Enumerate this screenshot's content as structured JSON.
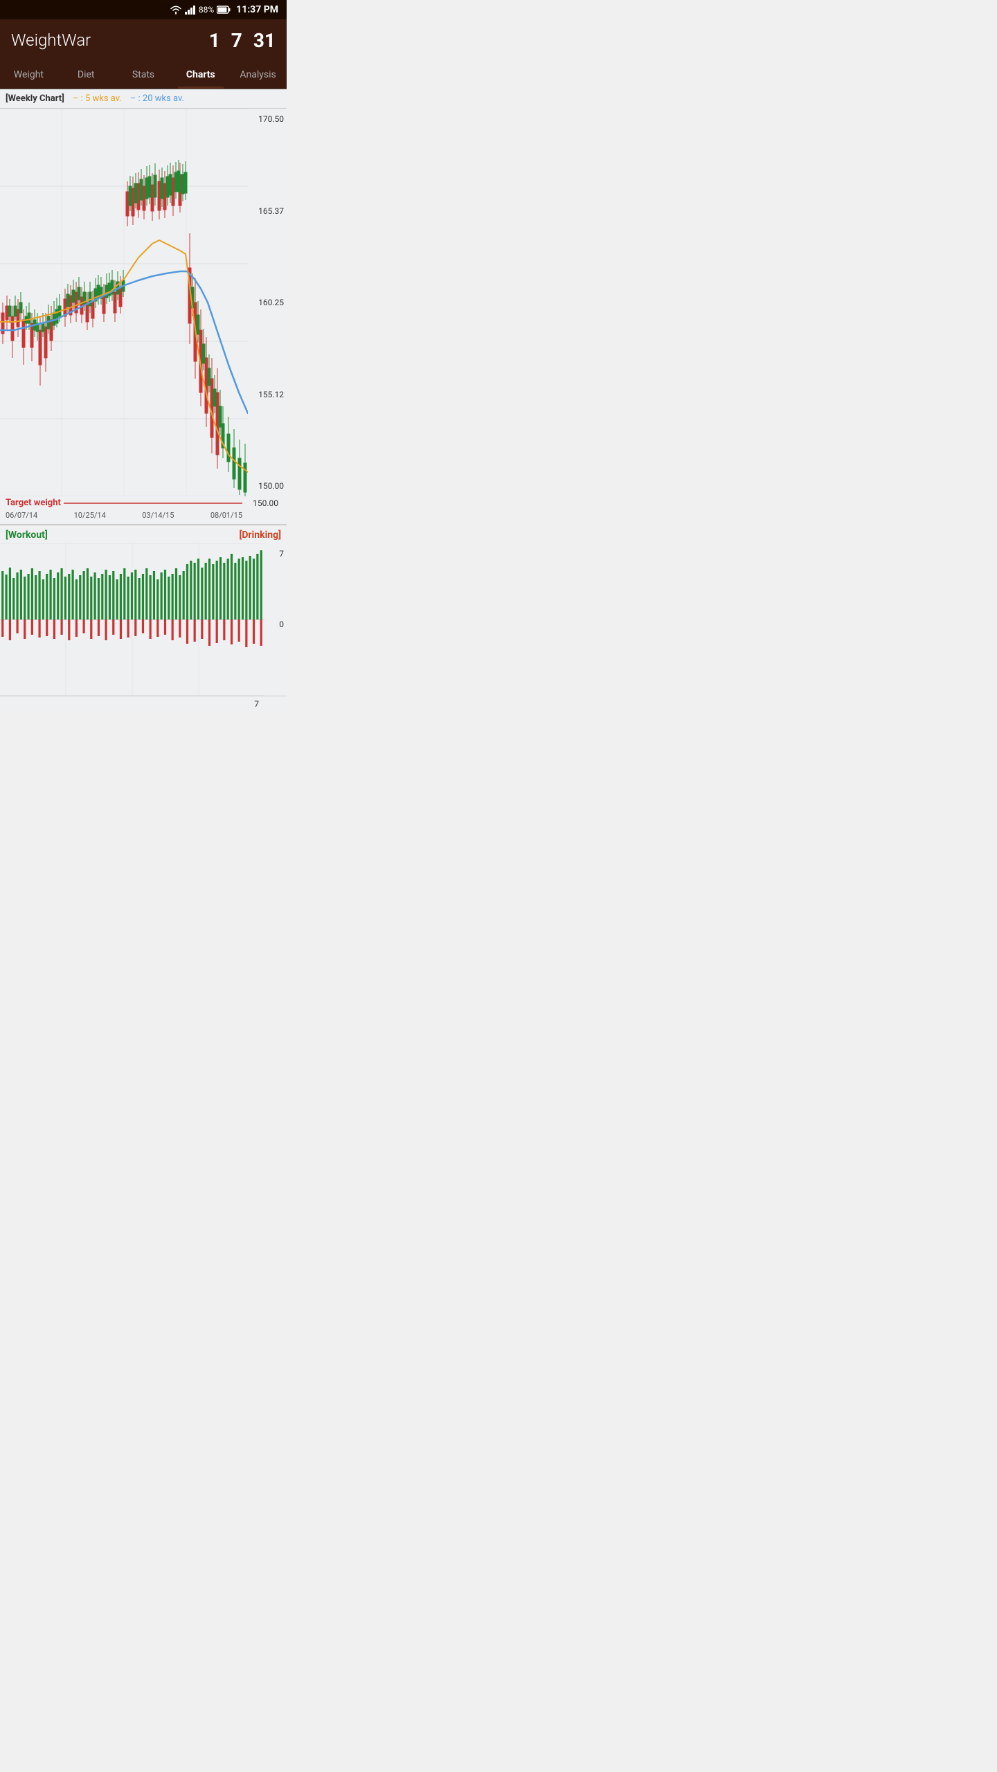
{
  "statusBar": {
    "time": "11:37 PM",
    "battery": "88%",
    "wifiIcon": "wifi",
    "signalIcon": "signal",
    "batteryIcon": "battery"
  },
  "header": {
    "title": "WeightWar",
    "num1": "1",
    "num7": "7",
    "num31": "31"
  },
  "tabs": [
    {
      "label": "Weight",
      "active": false
    },
    {
      "label": "Diet",
      "active": false
    },
    {
      "label": "Stats",
      "active": false
    },
    {
      "label": "Charts",
      "active": true
    },
    {
      "label": "Analysis",
      "active": false
    }
  ],
  "chart": {
    "legend": {
      "title": "[Weekly Chart]",
      "line1": "– : 5 wks av.",
      "line2": "– : 20 wks av."
    },
    "yAxis": [
      "170.50",
      "165.37",
      "160.25",
      "155.12",
      "150.00"
    ],
    "xAxis": [
      "06/07/14",
      "10/25/14",
      "03/14/15",
      "08/01/15"
    ],
    "targetLabel": "Target weight",
    "targetValue": "150.00"
  },
  "workoutChart": {
    "workoutLabel": "[Workout]",
    "drinkingLabel": "[Drinking]",
    "yAxisHigh": "7",
    "yAxisMid": "0",
    "yAxisLow": "7"
  },
  "colors": {
    "headerBg": "#3b1a10",
    "statusBg": "#1a0a00",
    "chartBg": "#eef0f2",
    "candleRed": "#cc3333",
    "candleGreen": "#228833",
    "avgOrange": "#e8a020",
    "avgBlue": "#5599dd",
    "targetRed": "#cc3333",
    "gridLine": "#cccccc"
  }
}
